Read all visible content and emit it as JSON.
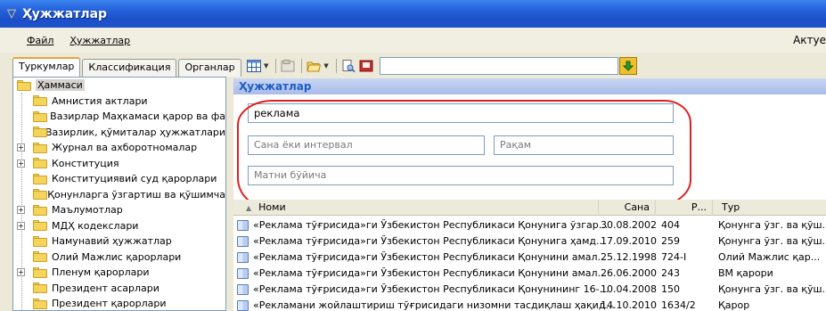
{
  "window": {
    "title": "Ҳужжатлар"
  },
  "menubar": {
    "items": [
      "Файл",
      "Ҳужжатлар"
    ],
    "right_label": "Актуе"
  },
  "left": {
    "tabs": [
      "Туркумлар",
      "Классификация",
      "Органлар"
    ],
    "tree": [
      {
        "label": "Ҳаммаси",
        "level": 0
      },
      {
        "label": "Амнистия актлари",
        "level": 1
      },
      {
        "label": "Вазирлар Маҳкамаси қарор ва фа",
        "level": 1
      },
      {
        "label": "Вазирлик, қўмиталар ҳужжатлари",
        "level": 1
      },
      {
        "label": "Журнал ва ахборотномалар",
        "level": 1,
        "expandable": true
      },
      {
        "label": "Конституция",
        "level": 1,
        "expandable": true
      },
      {
        "label": "Конституциявий суд қарорлари",
        "level": 1
      },
      {
        "label": "Қонунларга ўзгартиш ва қўшимча",
        "level": 1
      },
      {
        "label": "Маълумотлар",
        "level": 1,
        "expandable": true
      },
      {
        "label": "МДҲ кодекслари",
        "level": 1,
        "expandable": true
      },
      {
        "label": "Намунавий ҳужжатлар",
        "level": 1
      },
      {
        "label": "Олий Мажлис қарорлари",
        "level": 1
      },
      {
        "label": "Пленум қарорлари",
        "level": 1,
        "expandable": true
      },
      {
        "label": "Президент асарлари",
        "level": 1
      },
      {
        "label": "Президент қарорлари",
        "level": 1
      }
    ]
  },
  "main": {
    "section_title": "Ҳужжатлар",
    "search": {
      "text_value": "реклама",
      "date_placeholder": "Сана ёки интервал",
      "number_placeholder": "Рақам",
      "content_placeholder": "Матни бўйича"
    },
    "list": {
      "columns": [
        "Номи",
        "Сана",
        "Р...",
        "Тур"
      ],
      "rows": [
        {
          "name": "«Реклама тўғрисида»ги Ўзбекистон Республикаси Қонунига ўзгар...",
          "date": "30.08.2002",
          "num": "404",
          "type": "Қонунга ўзг. ва қўш."
        },
        {
          "name": "«Реклама тўғрисида»ги Ўзбекистон Республикаси Қонунига ҳамд...",
          "date": "17.09.2010",
          "num": "259",
          "type": "Қонунга ўзг. ва қўш."
        },
        {
          "name": "«Реклама тўғрисида»ги Ўзбекистон Республикаси Қонунини амал...",
          "date": "25.12.1998",
          "num": "724-I",
          "type": "Олий Мажлис қар..."
        },
        {
          "name": "«Реклама тўғрисида»ги Ўзбекистон Республикаси Қонунини амал...",
          "date": "26.06.2000",
          "num": "243",
          "type": "ВМ қарори"
        },
        {
          "name": "«Реклама тўғрисида»ги Ўзбекистон Республикаси Қонунининг 16-...",
          "date": "10.04.2008",
          "num": "150",
          "type": "Қонунга ўзг. ва қўш."
        },
        {
          "name": "«Рекламани жойлаштириш тўғрисидаги низомни тасдиқлаш ҳақид...",
          "date": "14.10.2010",
          "num": "1634/2",
          "type": "Қарор"
        }
      ]
    }
  },
  "icons": [
    "app-icon",
    "grid-view-icon",
    "properties-icon",
    "open-folder-icon",
    "print-preview-icon",
    "export-icon",
    "go-arrow-icon",
    "folder-icon",
    "document-icon"
  ]
}
